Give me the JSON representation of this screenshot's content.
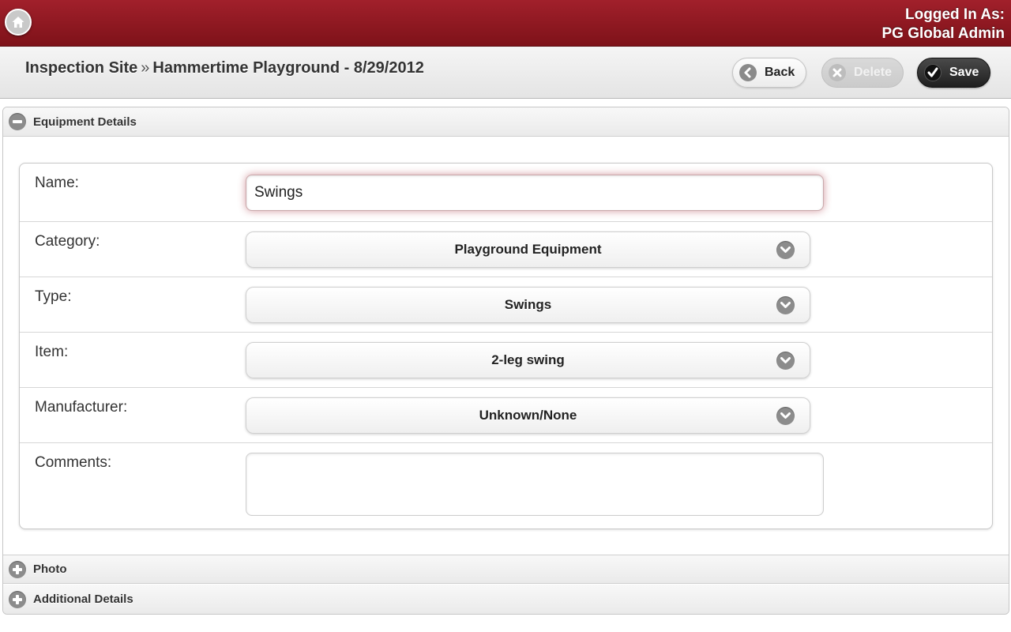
{
  "topbar": {
    "home_icon": "home-icon",
    "login_line1": "Logged In As:",
    "login_line2": "PG Global Admin"
  },
  "header": {
    "breadcrumb_parent": "Inspection Site",
    "breadcrumb_separator": "»",
    "page_title": "Hammertime Playground - 8/29/2012",
    "back_label": "Back",
    "delete_label": "Delete",
    "save_label": "Save"
  },
  "sections": {
    "equipment_details": "Equipment Details",
    "photo": "Photo",
    "additional_details": "Additional Details"
  },
  "form": {
    "name_label": "Name:",
    "name_value": "Swings",
    "category_label": "Category:",
    "category_value": "Playground Equipment",
    "type_label": "Type:",
    "type_value": "Swings",
    "item_label": "Item:",
    "item_value": "2-leg swing",
    "manufacturer_label": "Manufacturer:",
    "manufacturer_value": "Unknown/None",
    "comments_label": "Comments:",
    "comments_value": ""
  },
  "colors": {
    "brand_red": "#8f1820",
    "save_dark": "#2a2a2a",
    "icon_gray": "#8c8c8c"
  }
}
